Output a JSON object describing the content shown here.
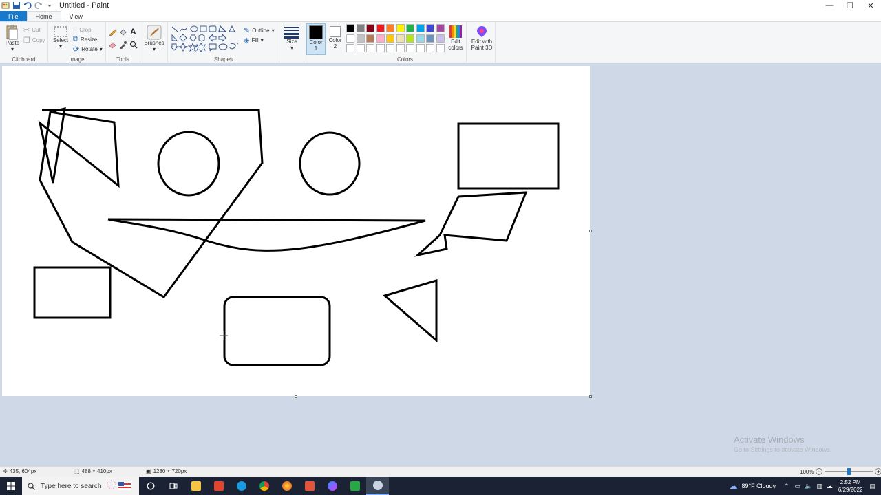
{
  "window": {
    "title": "Untitled - Paint",
    "minimize": "—",
    "maximize": "❐",
    "close": "✕"
  },
  "tabs": [
    {
      "label": "File"
    },
    {
      "label": "Home"
    },
    {
      "label": "View"
    }
  ],
  "ribbon": {
    "clipboard": {
      "group_label": "Clipboard",
      "paste": "Paste",
      "cut": "Cut",
      "copy": "Copy"
    },
    "image": {
      "group_label": "Image",
      "select": "Select",
      "crop": "Crop",
      "resize": "Resize",
      "rotate": "Rotate"
    },
    "tools": {
      "group_label": "Tools"
    },
    "brushes": {
      "label": "Brushes"
    },
    "shapes": {
      "group_label": "Shapes",
      "outline": "Outline",
      "fill": "Fill"
    },
    "size": {
      "label": "Size"
    },
    "color1": {
      "label_a": "Color",
      "label_b": "1",
      "value": "#000000"
    },
    "color2": {
      "label_a": "Color",
      "label_b": "2",
      "value": "#ffffff"
    },
    "colors": {
      "group_label": "Colors",
      "row1": [
        "#000000",
        "#7f7f7f",
        "#880015",
        "#ed1c24",
        "#ff7f27",
        "#fff200",
        "#22b14c",
        "#00a2e8",
        "#3f48cc",
        "#a349a4"
      ],
      "row2": [
        "#ffffff",
        "#c3c3c3",
        "#b97a57",
        "#ffaec9",
        "#ffc90e",
        "#efe4b0",
        "#b5e61d",
        "#99d9ea",
        "#7092be",
        "#c8bfe7"
      ],
      "row3": [
        "#ffffff",
        "#ffffff",
        "#ffffff",
        "#ffffff",
        "#ffffff",
        "#ffffff",
        "#ffffff",
        "#ffffff",
        "#ffffff",
        "#ffffff"
      ]
    },
    "edit_colors": {
      "label_a": "Edit",
      "label_b": "colors"
    },
    "paint3d": {
      "label_a": "Edit with",
      "label_b": "Paint 3D"
    }
  },
  "watermark": {
    "line1": "Activate Windows",
    "line2": "Go to Settings to activate Windows."
  },
  "status": {
    "cursor": "435, 604px",
    "selection": "488 × 410px",
    "canvas_size": "1280 × 720px",
    "zoom": "100%"
  },
  "taskbar": {
    "search_placeholder": "Type here to search",
    "weather": "89°F  Cloudy",
    "time": "2:52 PM",
    "date": "6/29/2022"
  }
}
